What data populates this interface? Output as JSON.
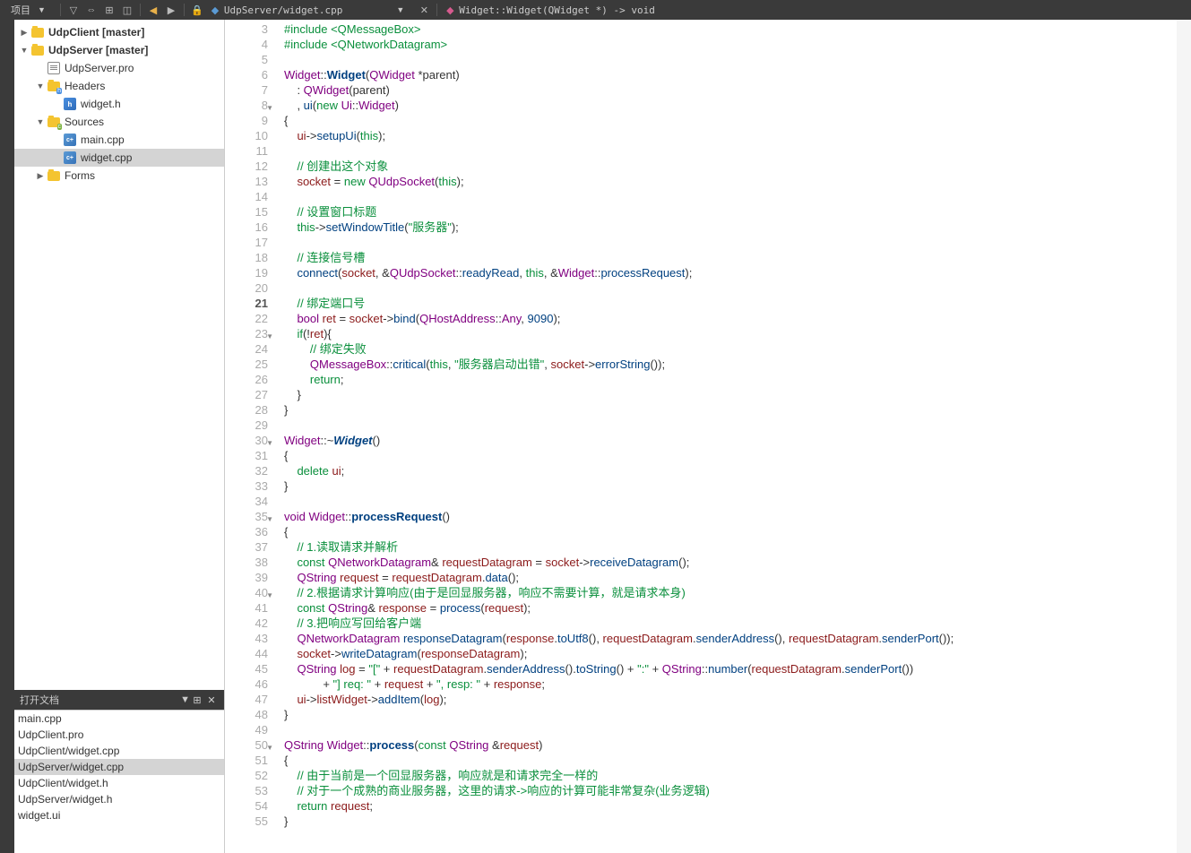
{
  "toolbar": {
    "title": "项目",
    "filePath": "UdpServer/widget.cpp",
    "breadcrumb": "Widget::Widget(QWidget *) -> void"
  },
  "tree": {
    "udpClient": "UdpClient [master]",
    "udpServer": "UdpServer [master]",
    "proFile": "UdpServer.pro",
    "headers": "Headers",
    "widgetH": "widget.h",
    "sources": "Sources",
    "mainCpp": "main.cpp",
    "widgetCpp": "widget.cpp",
    "forms": "Forms"
  },
  "openDocs": {
    "title": "打开文档",
    "items": [
      "main.cpp",
      "UdpClient.pro",
      "UdpClient/widget.cpp",
      "UdpServer/widget.cpp",
      "UdpClient/widget.h",
      "UdpServer/widget.h",
      "widget.ui"
    ],
    "selectedIndex": 3
  },
  "editor": {
    "startLine": 3,
    "currentLine": 21,
    "foldLines": [
      8,
      23,
      30,
      35,
      40,
      50
    ],
    "lines": [
      {
        "n": 3,
        "h": "<span class='kw'>#include</span> <span class='inc'>&lt;QMessageBox&gt;</span>"
      },
      {
        "n": 4,
        "h": "<span class='kw'>#include</span> <span class='inc'>&lt;QNetworkDatagram&gt;</span>"
      },
      {
        "n": 5,
        "h": ""
      },
      {
        "n": 6,
        "h": "<span class='type'>Widget</span>::<span class='fnb'>Widget</span>(<span class='type'>QWidget</span> *parent)"
      },
      {
        "n": 7,
        "h": "    : <span class='type'>QWidget</span>(parent)"
      },
      {
        "n": 8,
        "h": "    , <span class='fn'>ui</span>(<span class='kw'>new</span> <span class='type'>Ui</span>::<span class='type'>Widget</span>)"
      },
      {
        "n": 9,
        "h": "{"
      },
      {
        "n": 10,
        "h": "    <span class='id'>ui</span>-&gt;<span class='fn'>setupUi</span>(<span class='kw'>this</span>);"
      },
      {
        "n": 11,
        "h": ""
      },
      {
        "n": 12,
        "h": "    <span class='cm'>// 创建出这个对象</span>"
      },
      {
        "n": 13,
        "h": "    <span class='id'>socket</span> = <span class='kw'>new</span> <span class='type'>QUdpSocket</span>(<span class='kw'>this</span>);"
      },
      {
        "n": 14,
        "h": ""
      },
      {
        "n": 15,
        "h": "    <span class='cm'>// 设置窗口标题</span>"
      },
      {
        "n": 16,
        "h": "    <span class='kw'>this</span>-&gt;<span class='fn'>setWindowTitle</span>(<span class='str'>\"服务器\"</span>);"
      },
      {
        "n": 17,
        "h": ""
      },
      {
        "n": 18,
        "h": "    <span class='cm'>// 连接信号槽</span>"
      },
      {
        "n": 19,
        "h": "    <span class='fn'>connect</span>(<span class='id'>socket</span>, &amp;<span class='type'>QUdpSocket</span>::<span class='fn'>readyRead</span>, <span class='kw'>this</span>, &amp;<span class='type'>Widget</span>::<span class='fn'>processRequest</span>);"
      },
      {
        "n": 20,
        "h": ""
      },
      {
        "n": 21,
        "h": "    <span class='cm'>// 绑定端口号</span>"
      },
      {
        "n": 22,
        "h": "    <span class='type'>bool</span> <span class='id'>ret</span> = <span class='id'>socket</span>-&gt;<span class='fn'>bind</span>(<span class='type'>QHostAddress</span>::<span class='type'>Any</span>, <span class='num'>9090</span>);"
      },
      {
        "n": 23,
        "h": "    <span class='kw'>if</span>(!<span class='id'>ret</span>){"
      },
      {
        "n": 24,
        "h": "        <span class='cm'>// 绑定失败</span>"
      },
      {
        "n": 25,
        "h": "        <span class='type'>QMessageBox</span>::<span class='fn'>critical</span>(<span class='kw'>this</span>, <span class='str'>\"服务器启动出错\"</span>, <span class='id'>socket</span>-&gt;<span class='fn'>errorString</span>());"
      },
      {
        "n": 26,
        "h": "        <span class='kw'>return</span>;"
      },
      {
        "n": 27,
        "h": "    }"
      },
      {
        "n": 28,
        "h": "}"
      },
      {
        "n": 29,
        "h": ""
      },
      {
        "n": 30,
        "h": "<span class='type'>Widget</span>::~<span class='fni'>Widget</span>()"
      },
      {
        "n": 31,
        "h": "{"
      },
      {
        "n": 32,
        "h": "    <span class='kw'>delete</span> <span class='id'>ui</span>;"
      },
      {
        "n": 33,
        "h": "}"
      },
      {
        "n": 34,
        "h": ""
      },
      {
        "n": 35,
        "h": "<span class='type'>void</span> <span class='type'>Widget</span>::<span class='fnb'>processRequest</span>()"
      },
      {
        "n": 36,
        "h": "{"
      },
      {
        "n": 37,
        "h": "    <span class='cm'>// 1.读取请求并解析</span>"
      },
      {
        "n": 38,
        "h": "    <span class='kw'>const</span> <span class='type'>QNetworkDatagram</span>&amp; <span class='id'>requestDatagram</span> = <span class='id'>socket</span>-&gt;<span class='fn'>receiveDatagram</span>();"
      },
      {
        "n": 39,
        "h": "    <span class='type'>QString</span> <span class='id'>request</span> = <span class='id'>requestDatagram</span>.<span class='fn'>data</span>();"
      },
      {
        "n": 40,
        "h": "    <span class='cm'>// 2.根据请求计算响应(由于是回显服务器，响应不需要计算，就是请求本身)</span>"
      },
      {
        "n": 41,
        "h": "    <span class='kw'>const</span> <span class='type'>QString</span>&amp; <span class='id'>response</span> = <span class='fn'>process</span>(<span class='id'>request</span>);"
      },
      {
        "n": 42,
        "h": "    <span class='cm'>// 3.把响应写回给客户端</span>"
      },
      {
        "n": 43,
        "h": "    <span class='type'>QNetworkDatagram</span> <span class='fn'>responseDatagram</span>(<span class='id'>response</span>.<span class='fn'>toUtf8</span>(), <span class='id'>requestDatagram</span>.<span class='fn'>senderAddress</span>(), <span class='id'>requestDatagram</span>.<span class='fn'>senderPort</span>());"
      },
      {
        "n": 44,
        "h": "    <span class='id'>socket</span>-&gt;<span class='fn'>writeDatagram</span>(<span class='id'>responseDatagram</span>);"
      },
      {
        "n": 45,
        "h": "    <span class='type'>QString</span> <span class='id'>log</span> = <span class='str'>\"[\"</span> + <span class='id'>requestDatagram</span>.<span class='fn'>senderAddress</span>().<span class='fn'>toString</span>() + <span class='str'>\":\"</span> + <span class='type'>QString</span>::<span class='fn'>number</span>(<span class='id'>requestDatagram</span>.<span class='fn'>senderPort</span>())"
      },
      {
        "n": 46,
        "h": "            + <span class='str'>\"] req: \"</span> + <span class='id'>request</span> + <span class='str'>\", resp: \"</span> + <span class='id'>response</span>;"
      },
      {
        "n": 47,
        "h": "    <span class='id'>ui</span>-&gt;<span class='id'>listWidget</span>-&gt;<span class='fn'>addItem</span>(<span class='id'>log</span>);"
      },
      {
        "n": 48,
        "h": "}"
      },
      {
        "n": 49,
        "h": ""
      },
      {
        "n": 50,
        "h": "<span class='type'>QString</span> <span class='type'>Widget</span>::<span class='fnb'>process</span>(<span class='kw'>const</span> <span class='type'>QString</span> &amp;<span class='id'>request</span>)"
      },
      {
        "n": 51,
        "h": "{"
      },
      {
        "n": 52,
        "h": "    <span class='cm'>// 由于当前是一个回显服务器，响应就是和请求完全一样的</span>"
      },
      {
        "n": 53,
        "h": "    <span class='cm'>// 对于一个成熟的商业服务器，这里的请求-&gt;响应的计算可能非常复杂(业务逻辑)</span>"
      },
      {
        "n": 54,
        "h": "    <span class='kw'>return</span> <span class='id'>request</span>;"
      },
      {
        "n": 55,
        "h": "}"
      }
    ]
  }
}
